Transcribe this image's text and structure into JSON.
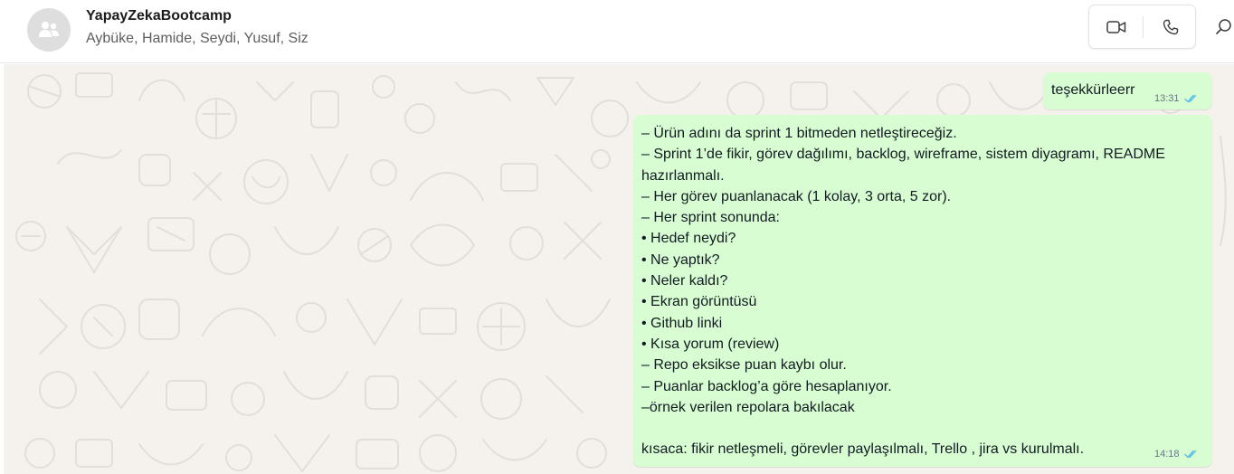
{
  "header": {
    "chat_title": "YapayZekaBootcamp",
    "members": "Aybüke, Hamide, Seydi, Yusuf, Siz",
    "avatar_icon": "group-icon",
    "video_icon": "video-call-icon",
    "voice_icon": "phone-icon",
    "search_icon": "search-icon"
  },
  "colors": {
    "outgoing_bubble": "#d9fdd3",
    "chat_background": "#f5f2ee",
    "read_ticks": "#53bdeb"
  },
  "messages": [
    {
      "text": "teşekkürleerr",
      "time": "13:31",
      "status": "read"
    },
    {
      "lines": [
        "– Ürün adını da sprint 1 bitmeden netleştireceğiz.",
        "– Sprint 1’de fikir, görev dağılımı, backlog, wireframe, sistem diyagramı, README",
        "hazırlanmalı.",
        "– Her görev puanlanacak (1 kolay, 3 orta, 5 zor).",
        "– Her sprint sonunda:",
        "• Hedef neydi?",
        "• Ne yaptık?",
        "• Neler kaldı?",
        "• Ekran görüntüsü",
        "• Github linki",
        "• Kısa yorum (review)",
        "– Repo eksikse puan kaybı olur.",
        "– Puanlar backlog’a göre hesaplanıyor.",
        "–örnek verilen repolara bakılacak",
        "",
        "kısaca: fikir netleşmeli, görevler paylaşılmalı, Trello , jira vs kurulmalı."
      ],
      "time": "14:18",
      "status": "read"
    }
  ]
}
